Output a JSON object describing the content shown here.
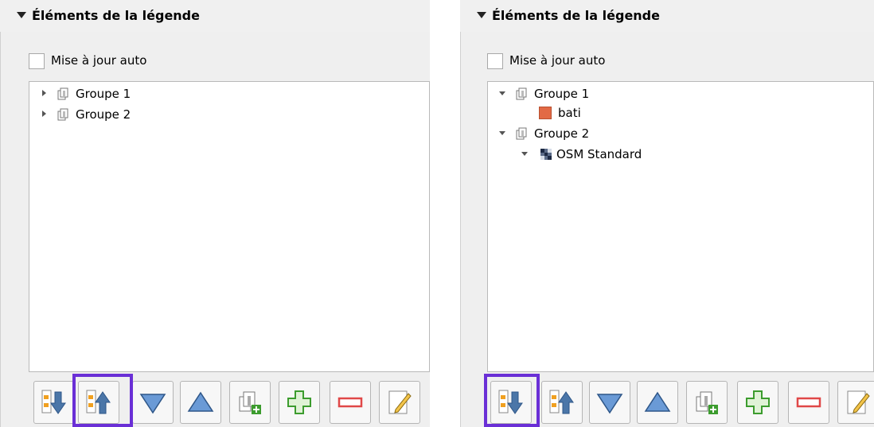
{
  "left": {
    "header_title": "Éléments de la légende",
    "auto_update_label": "Mise à jour auto",
    "tree": [
      {
        "label": "Groupe 1",
        "expanded": false
      },
      {
        "label": "Groupe 2",
        "expanded": false
      }
    ],
    "highlighted_button": "move-up"
  },
  "right": {
    "header_title": "Éléments de la légende",
    "auto_update_label": "Mise à jour auto",
    "tree": [
      {
        "label": "Groupe 1",
        "expanded": true,
        "children": [
          {
            "label": "bati",
            "symbol_color": "#e26a45"
          }
        ]
      },
      {
        "label": "Groupe 2",
        "expanded": true,
        "children": [
          {
            "label": "OSM Standard",
            "type": "raster",
            "expanded": true
          }
        ]
      }
    ],
    "highlighted_button": "move-down"
  },
  "toolbar_icons": [
    "move-down-icon",
    "move-up-icon",
    "triangle-down-icon",
    "triangle-up-icon",
    "add-group-icon",
    "add-item-icon",
    "remove-item-icon",
    "edit-item-icon"
  ],
  "colors": {
    "highlight": "#6a2fd6",
    "add": "#3c9c2e",
    "remove": "#e04848",
    "arrow": "#4b76a8",
    "swatch": "#e26a45"
  }
}
